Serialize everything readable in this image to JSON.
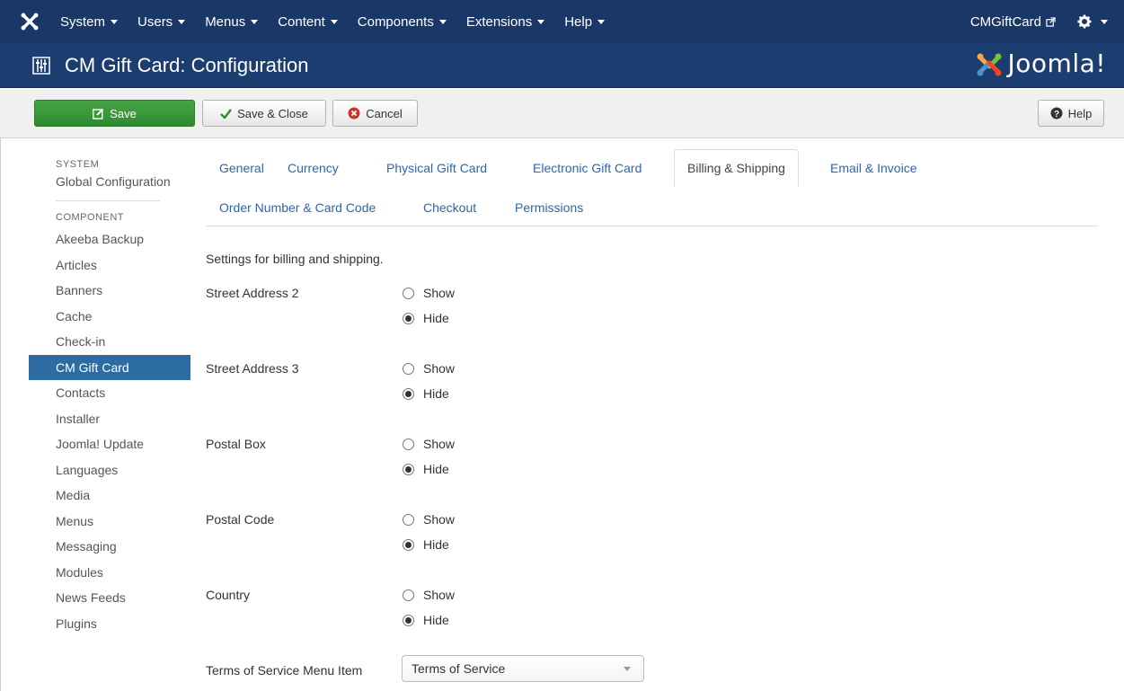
{
  "nav": {
    "items": [
      {
        "label": "System",
        "name": "nav-system"
      },
      {
        "label": "Users",
        "name": "nav-users"
      },
      {
        "label": "Menus",
        "name": "nav-menus"
      },
      {
        "label": "Content",
        "name": "nav-content"
      },
      {
        "label": "Components",
        "name": "nav-components"
      },
      {
        "label": "Extensions",
        "name": "nav-extensions"
      },
      {
        "label": "Help",
        "name": "nav-help"
      }
    ],
    "site_link": "CMGiftCard"
  },
  "header": {
    "title": "CM Gift Card: Configuration",
    "brand": "Joomla!"
  },
  "toolbar": {
    "save_label": "Save",
    "save_close_label": "Save & Close",
    "cancel_label": "Cancel",
    "help_label": "Help"
  },
  "sidebar": {
    "system_heading": "SYSTEM",
    "global_config": "Global Configuration",
    "component_heading": "COMPONENT",
    "items": [
      "Akeeba Backup",
      "Articles",
      "Banners",
      "Cache",
      "Check-in",
      "CM Gift Card",
      "Contacts",
      "Installer",
      "Joomla! Update",
      "Languages",
      "Media",
      "Menus",
      "Messaging",
      "Modules",
      "News Feeds",
      "Plugins"
    ],
    "active_item": "CM Gift Card"
  },
  "tabs": [
    "General",
    "Currency",
    "Physical Gift Card",
    "Electronic Gift Card",
    "Billing & Shipping",
    "Email & Invoice",
    "Order Number & Card Code",
    "Checkout",
    "Permissions"
  ],
  "active_tab": "Billing & Shipping",
  "form": {
    "description": "Settings for billing and shipping.",
    "show_label": "Show",
    "hide_label": "Hide",
    "fields": [
      {
        "label": "Street Address 2",
        "value": "Hide"
      },
      {
        "label": "Street Address 3",
        "value": "Hide"
      },
      {
        "label": "Postal Box",
        "value": "Hide"
      },
      {
        "label": "Postal Code",
        "value": "Hide"
      },
      {
        "label": "Country",
        "value": "Hide"
      }
    ],
    "tos_label": "Terms of Service Menu Item",
    "tos_value": "Terms of Service"
  },
  "colors": {
    "navbar": "#1a3867",
    "titlebar": "#1c3d6f",
    "save_button": "#3d9a3d",
    "sidebar_active": "#2d6ca2",
    "link": "#2b66b3"
  }
}
